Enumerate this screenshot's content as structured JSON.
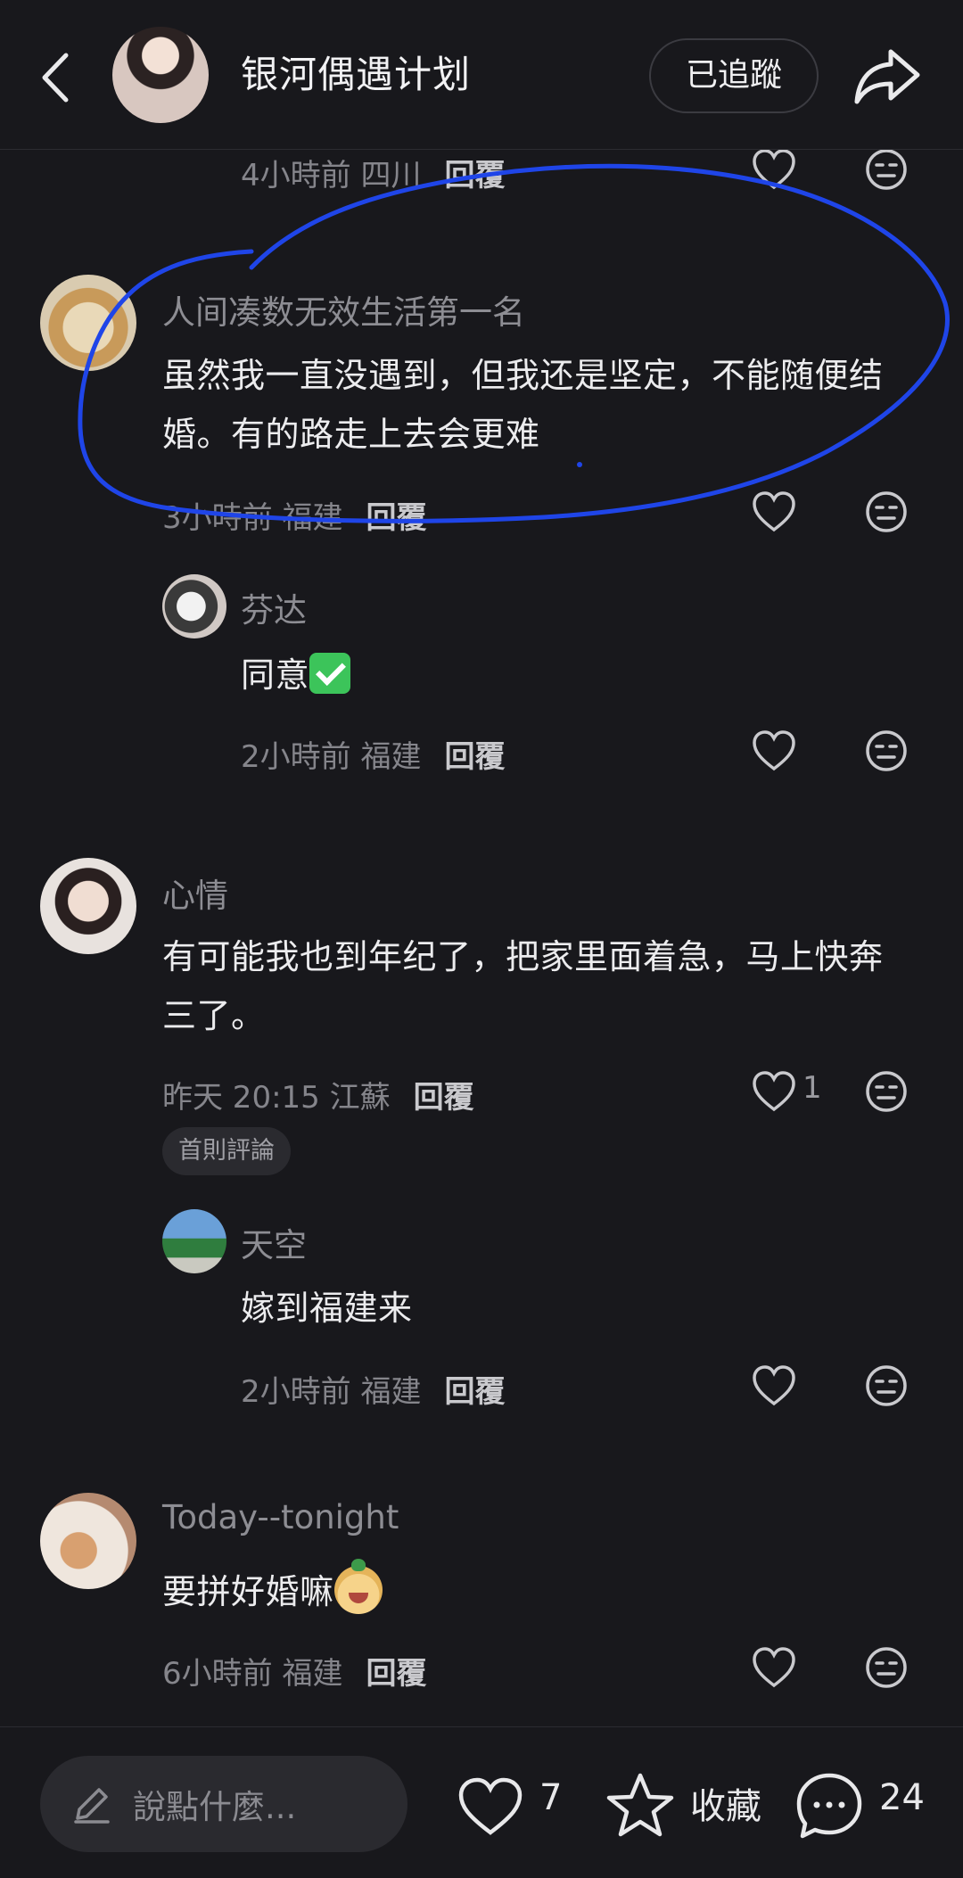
{
  "header": {
    "title": "银河偶遇计划",
    "follow_label": "已追蹤"
  },
  "comments": [
    {
      "meta": "4小時前 四川",
      "reply": "回覆"
    },
    {
      "username": "人间凑数无效生活第一名",
      "text_line1": "虽然我一直没遇到，但我还是坚定，不能随便结",
      "text_line2": "婚。有的路走上去会更难",
      "meta": "3小時前 福建",
      "reply": "回覆",
      "replies": [
        {
          "username": "芬达",
          "text": "同意",
          "meta": "2小時前 福建",
          "reply": "回覆"
        }
      ]
    },
    {
      "username": "心情",
      "text_line1": "有可能我也到年纪了，把家里面着急，马上快奔",
      "text_line2": "三了。",
      "meta": "昨天 20:15 江蘇",
      "reply": "回覆",
      "likes": "1",
      "badge": "首則評論",
      "replies": [
        {
          "username": "天空",
          "text": "嫁到福建来",
          "meta": "2小時前 福建",
          "reply": "回覆"
        }
      ]
    },
    {
      "username": "Today--tonight",
      "text": "要拼好婚嘛",
      "meta": "6小時前 福建",
      "reply": "回覆"
    }
  ],
  "bottom_bar": {
    "input_placeholder": "說點什麼...",
    "like_count": "7",
    "favorite_label": "收藏",
    "comment_count": "24"
  },
  "colors": {
    "background": "#18181c",
    "annotation_stroke": "#1f45e8",
    "muted_text": "#85858b"
  },
  "icons": [
    "back-icon",
    "share-icon",
    "heart-icon",
    "dislike-face-icon",
    "pencil-icon",
    "star-icon",
    "chat-bubble-icon"
  ]
}
